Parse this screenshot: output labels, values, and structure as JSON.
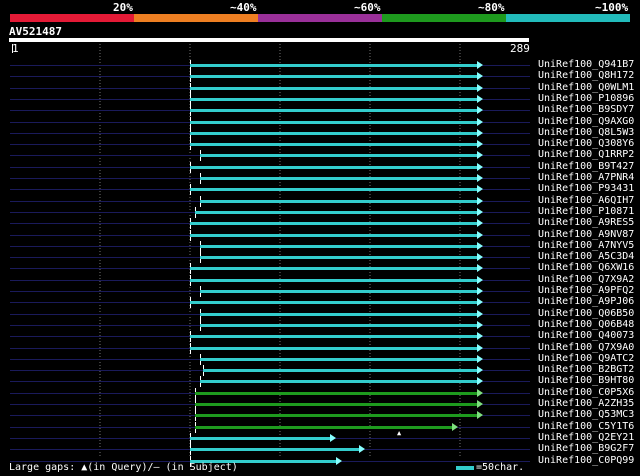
{
  "identity_scale": [
    {
      "label": "20%",
      "color": "#e41a36"
    },
    {
      "label": "~40%",
      "color": "#ee7f22"
    },
    {
      "label": "~60%",
      "color": "#9a3099"
    },
    {
      "label": "~80%",
      "color": "#1e9a1e"
    },
    {
      "label": "~100%",
      "color": "#22bbbb"
    }
  ],
  "query": {
    "id": "AV521487",
    "start_label": "1",
    "end_label": "289",
    "length": 289
  },
  "hits": [
    {
      "name": "UniRef100_Q941B7",
      "start": 111,
      "end": 289,
      "color": "#3cc"
    },
    {
      "name": "UniRef100_Q8H172",
      "start": 111,
      "end": 289,
      "color": "#3cc"
    },
    {
      "name": "UniRef100_Q0WLM1",
      "start": 111,
      "end": 289,
      "color": "#3cc"
    },
    {
      "name": "UniRef100_P10896",
      "start": 111,
      "end": 289,
      "color": "#3cc"
    },
    {
      "name": "UniRef100_B9SDY7",
      "start": 111,
      "end": 289,
      "color": "#3cc"
    },
    {
      "name": "UniRef100_Q9AXG0",
      "start": 111,
      "end": 289,
      "color": "#3cc"
    },
    {
      "name": "UniRef100_Q8L5W3",
      "start": 111,
      "end": 289,
      "color": "#3cc"
    },
    {
      "name": "UniRef100_Q308Y6",
      "start": 111,
      "end": 289,
      "color": "#3cc"
    },
    {
      "name": "UniRef100_Q1RRP2",
      "start": 117,
      "end": 289,
      "color": "#3cc"
    },
    {
      "name": "UniRef100_B9T427",
      "start": 111,
      "end": 289,
      "color": "#3cc"
    },
    {
      "name": "UniRef100_A7PNR4",
      "start": 117,
      "end": 289,
      "color": "#3cc"
    },
    {
      "name": "UniRef100_P93431",
      "start": 111,
      "end": 289,
      "color": "#3cc"
    },
    {
      "name": "UniRef100_A6QIH7",
      "start": 117,
      "end": 289,
      "color": "#3cc"
    },
    {
      "name": "UniRef100_P10871",
      "start": 114,
      "end": 289,
      "color": "#3cc"
    },
    {
      "name": "UniRef100_A9RES5",
      "start": 111,
      "end": 289,
      "color": "#3cc"
    },
    {
      "name": "UniRef100_A9NV87",
      "start": 111,
      "end": 289,
      "color": "#3cc"
    },
    {
      "name": "UniRef100_A7NYV5",
      "start": 117,
      "end": 289,
      "color": "#3cc"
    },
    {
      "name": "UniRef100_A5C3D4",
      "start": 117,
      "end": 289,
      "color": "#3cc"
    },
    {
      "name": "UniRef100_Q6XW16",
      "start": 111,
      "end": 289,
      "color": "#3cc"
    },
    {
      "name": "UniRef100_Q7X9A2",
      "start": 111,
      "end": 289,
      "color": "#3cc"
    },
    {
      "name": "UniRef100_A9PFQ2",
      "start": 117,
      "end": 289,
      "color": "#3cc"
    },
    {
      "name": "UniRef100_A9PJ06",
      "start": 111,
      "end": 289,
      "color": "#3cc"
    },
    {
      "name": "UniRef100_Q06B50",
      "start": 117,
      "end": 289,
      "color": "#3cc"
    },
    {
      "name": "UniRef100_Q06B48",
      "start": 117,
      "end": 289,
      "color": "#3cc"
    },
    {
      "name": "UniRef100_Q40073",
      "start": 111,
      "end": 289,
      "color": "#3cc"
    },
    {
      "name": "UniRef100_Q7X9A0",
      "start": 111,
      "end": 289,
      "color": "#3cc"
    },
    {
      "name": "UniRef100_Q9ATC2",
      "start": 117,
      "end": 289,
      "color": "#3cc"
    },
    {
      "name": "UniRef100_B2BGT2",
      "start": 119,
      "end": 289,
      "color": "#3cc"
    },
    {
      "name": "UniRef100_B9HT80",
      "start": 117,
      "end": 289,
      "color": "#3cc"
    },
    {
      "name": "UniRef100_C0P5X6",
      "start": 114,
      "end": 289,
      "color": "#1e9a1e"
    },
    {
      "name": "UniRef100_A2ZH35",
      "start": 114,
      "end": 289,
      "color": "#1e9a1e"
    },
    {
      "name": "UniRef100_Q53MC3",
      "start": 114,
      "end": 289,
      "color": "#1e9a1e"
    },
    {
      "name": "UniRef100_C5Y1T6",
      "start": 114,
      "end": 274,
      "color": "#1e9a1e",
      "gap_at": 239
    },
    {
      "name": "UniRef100_Q2EY21",
      "start": 111,
      "end": 199,
      "color": "#3cc"
    },
    {
      "name": "UniRef100_B9G2F7",
      "start": 111,
      "end": 217,
      "color": "#3cc"
    },
    {
      "name": "UniRef100_C0PQ99",
      "start": 111,
      "end": 203,
      "color": "#3cc"
    }
  ],
  "legend": {
    "left": "Large gaps: ▲(in Query)/‒ (in Subject)",
    "right": "=50char.",
    "swatch_color": "#3cc"
  }
}
